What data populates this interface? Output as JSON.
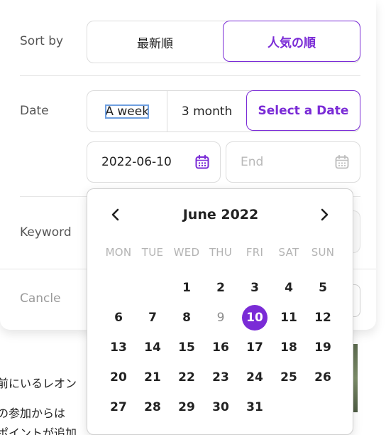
{
  "colors": {
    "accent": "#7a2bd6",
    "border": "#dcdcdc",
    "label": "#555555",
    "muted": "#b3b3b3"
  },
  "sort": {
    "label": "Sort by",
    "options": [
      {
        "label": "最新順",
        "active": false
      },
      {
        "label": "人気の順",
        "active": true
      }
    ]
  },
  "date": {
    "label": "Date",
    "options": [
      {
        "label": "A week",
        "focused": true
      },
      {
        "label": "3 month"
      },
      {
        "label": "Select a Date",
        "active": true
      }
    ],
    "start_value": "2022-06-10",
    "end_placeholder": "End"
  },
  "keyword": {
    "label": "Keyword"
  },
  "footer": {
    "cancel_label": "Cancle"
  },
  "calendar": {
    "title": "June 2022",
    "prev_icon": "chevron-left-icon",
    "next_icon": "chevron-right-icon",
    "weekdays": [
      "MON",
      "TUE",
      "WED",
      "THU",
      "FRI",
      "SAT",
      "SUN"
    ],
    "weeks": [
      [
        "",
        "",
        "1",
        "2",
        "3",
        "4",
        "5"
      ],
      [
        "6",
        "7",
        "8",
        "9",
        "10",
        "11",
        "12"
      ],
      [
        "13",
        "14",
        "15",
        "16",
        "17",
        "18",
        "19"
      ],
      [
        "20",
        "21",
        "22",
        "23",
        "24",
        "25",
        "26"
      ],
      [
        "27",
        "28",
        "29",
        "30",
        "31",
        "",
        ""
      ]
    ],
    "selected_day": "10",
    "muted_day": "9"
  },
  "article": {
    "lines": [
      "前にいるレオン",
      "の参加からは",
      "ポイントが追加"
    ]
  }
}
